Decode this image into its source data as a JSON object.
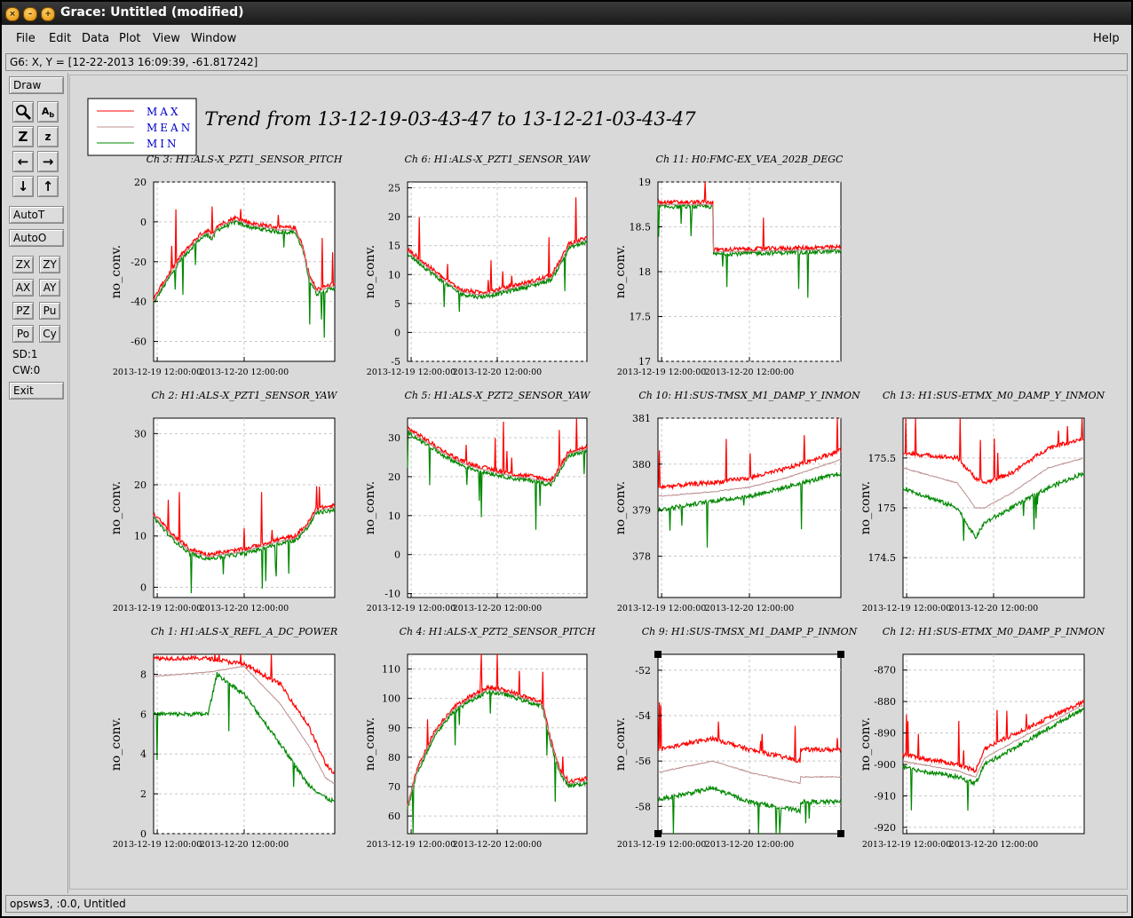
{
  "window": {
    "title": "Grace: Untitled (modified)"
  },
  "menubar": {
    "items": [
      "File",
      "Edit",
      "Data",
      "Plot",
      "View",
      "Window"
    ],
    "help": "Help"
  },
  "locator": "G6: X, Y = [12-22-2013 16:09:39, -61.817242]",
  "toolbar": {
    "draw": "Draw",
    "autot": "AutoT",
    "autoo": "AutoO",
    "zx": "ZX",
    "zy": "ZY",
    "ax": "AX",
    "ay": "AY",
    "pz": "PZ",
    "pu": "Pu",
    "po": "Po",
    "cy": "Cy",
    "sd": "SD:1",
    "cw": "CW:0",
    "exit": "Exit"
  },
  "statusbar": "opsws3, :0.0, Untitled",
  "plot": {
    "title": "Trend from 13-12-19-03-43-47 to 13-12-21-03-43-47",
    "legend": [
      "MAX",
      "MEAN",
      "MIN"
    ],
    "colors": {
      "max": "#ff0000",
      "mean": "#bc8f8f",
      "min": "#008800",
      "legend_text": "#0000cc"
    }
  },
  "chart_data": [
    {
      "type": "line",
      "title": "Ch 3: H1:ALS-X_PZT1_SENSOR_PITCH",
      "ylabel": "no_conv.",
      "ylim": [
        -70,
        20
      ],
      "yticks": [
        20,
        0,
        -20,
        -40,
        -60
      ],
      "xticks": [
        "2013-12-19 12:00:00",
        "2013-12-20 12:00:00"
      ],
      "series": [
        {
          "name": "MEAN",
          "x": [
            0,
            0.05,
            0.15,
            0.25,
            0.3,
            0.32,
            0.35,
            0.45,
            0.55,
            0.7,
            0.78,
            0.82,
            0.86,
            0.9,
            1.0
          ],
          "y": [
            -40,
            -32,
            -18,
            -8,
            -5,
            -8,
            -3,
            1,
            -2,
            -4,
            -4,
            -12,
            -28,
            -35,
            -32
          ]
        }
      ]
    },
    {
      "type": "line",
      "title": "Ch 6: H1:ALS-X_PZT1_SENSOR_YAW",
      "ylabel": "no_conv.",
      "ylim": [
        -5,
        26
      ],
      "yticks": [
        25,
        20,
        15,
        10,
        5,
        0,
        -5
      ],
      "xticks": [
        "2013-12-19 12:00:00",
        "2013-12-20 12:00:00"
      ],
      "series": [
        {
          "name": "MEAN",
          "x": [
            0,
            0.1,
            0.2,
            0.3,
            0.4,
            0.5,
            0.6,
            0.7,
            0.75,
            0.8,
            0.85,
            0.9,
            1.0
          ],
          "y": [
            14,
            11.5,
            9,
            7,
            6.5,
            7,
            7.8,
            8.5,
            9,
            9.5,
            12,
            15,
            16
          ]
        }
      ]
    },
    {
      "type": "line",
      "title": "Ch 11: H0:FMC-EX_VEA_202B_DEGC",
      "ylabel": "no_conv.",
      "ylim": [
        17,
        19
      ],
      "yticks": [
        19,
        18.5,
        18,
        17.5,
        17
      ],
      "xticks": [
        "2013-12-19 12:00:00",
        "2013-12-20 12:00:00"
      ],
      "series": [
        {
          "name": "MEAN",
          "x": [
            0,
            0.3,
            0.3,
            1.0
          ],
          "y": [
            18.75,
            18.75,
            18.22,
            18.25
          ]
        }
      ]
    },
    {
      "type": "line",
      "title": "Ch 2: H1:ALS-X_PZT1_SENSOR_YAW",
      "ylabel": "no_conv.",
      "ylim": [
        -2,
        33
      ],
      "yticks": [
        30,
        20,
        10,
        0
      ],
      "xticks": [
        "2013-12-19 12:00:00",
        "2013-12-20 12:00:00"
      ],
      "series": [
        {
          "name": "MEAN",
          "x": [
            0,
            0.1,
            0.2,
            0.3,
            0.4,
            0.5,
            0.6,
            0.7,
            0.78,
            0.85,
            0.9,
            1.0
          ],
          "y": [
            14,
            10,
            7,
            6,
            6.5,
            7,
            8,
            9,
            9.5,
            12,
            15,
            15.5
          ]
        }
      ]
    },
    {
      "type": "line",
      "title": "Ch 5: H1:ALS-X_PZT2_SENSOR_YAW",
      "ylabel": "no_conv.",
      "ylim": [
        -11,
        35
      ],
      "yticks": [
        30,
        20,
        10,
        0,
        -10
      ],
      "xticks": [
        "2013-12-19 12:00:00",
        "2013-12-20 12:00:00"
      ],
      "series": [
        {
          "name": "MEAN",
          "x": [
            0,
            0.1,
            0.2,
            0.3,
            0.4,
            0.5,
            0.6,
            0.7,
            0.75,
            0.8,
            0.85,
            0.9,
            1.0
          ],
          "y": [
            32,
            29,
            26,
            23.5,
            22,
            21,
            20,
            19.5,
            19,
            18.5,
            22,
            26,
            27
          ]
        }
      ]
    },
    {
      "type": "line",
      "title": "Ch 10: H1:SUS-TMSX_M1_DAMP_Y_INMON",
      "ylabel": "no_conv.",
      "ylim": [
        377.1,
        381
      ],
      "yticks": [
        381,
        380,
        379,
        378
      ],
      "xticks": [
        "2013-12-19 12:00:00",
        "2013-12-20 12:00:00"
      ],
      "series": [
        {
          "name": "MAX",
          "x": [
            0,
            0.3,
            0.5,
            0.7,
            1.0
          ],
          "y": [
            379.5,
            379.6,
            379.7,
            379.9,
            380.3
          ]
        },
        {
          "name": "MEAN",
          "x": [
            0,
            0.3,
            0.5,
            0.7,
            1.0
          ],
          "y": [
            379.3,
            379.4,
            379.5,
            379.7,
            380.1
          ]
        },
        {
          "name": "MIN",
          "x": [
            0,
            0.3,
            0.5,
            0.7,
            1.0
          ],
          "y": [
            379.0,
            379.2,
            379.3,
            379.5,
            379.8
          ]
        }
      ]
    },
    {
      "type": "line",
      "title": "Ch 13: H1:SUS-ETMX_M0_DAMP_Y_INMON",
      "ylabel": "no_conv.",
      "ylim": [
        174.1,
        175.9
      ],
      "yticks": [
        175.5,
        175,
        174.5
      ],
      "xticks": [
        "2013-12-19 12:00:00",
        "2013-12-20 12:00:00"
      ],
      "series": [
        {
          "name": "MAX",
          "x": [
            0,
            0.3,
            0.4,
            0.45,
            0.6,
            0.8,
            1.0
          ],
          "y": [
            175.55,
            175.5,
            175.3,
            175.25,
            175.35,
            175.6,
            175.7
          ]
        },
        {
          "name": "MEAN",
          "x": [
            0,
            0.3,
            0.4,
            0.45,
            0.6,
            0.8,
            1.0
          ],
          "y": [
            175.4,
            175.25,
            175.0,
            175.0,
            175.15,
            175.4,
            175.5
          ]
        },
        {
          "name": "MIN",
          "x": [
            0,
            0.3,
            0.4,
            0.45,
            0.6,
            0.8,
            1.0
          ],
          "y": [
            175.2,
            175.0,
            174.7,
            174.85,
            175.0,
            175.2,
            175.35
          ]
        }
      ]
    },
    {
      "type": "line",
      "title": "Ch 1: H1:ALS-X_REFL_A_DC_POWER",
      "ylabel": "no_conv.",
      "ylim": [
        0,
        9
      ],
      "yticks": [
        8,
        6,
        4,
        2,
        0
      ],
      "xticks": [
        "2013-12-19 12:00:00",
        "2013-12-20 12:00:00"
      ],
      "series": [
        {
          "name": "MAX",
          "x": [
            0,
            0.3,
            0.5,
            0.7,
            0.85,
            0.95,
            1.0
          ],
          "y": [
            8.8,
            8.8,
            8.5,
            7.5,
            5.5,
            3.5,
            3.0
          ]
        },
        {
          "name": "MEAN",
          "x": [
            0,
            0.3,
            0.5,
            0.7,
            0.85,
            0.95,
            1.0
          ],
          "y": [
            7.9,
            8.1,
            8.4,
            6.5,
            4.5,
            2.8,
            2.5
          ]
        },
        {
          "name": "MIN",
          "x": [
            0,
            0.3,
            0.35,
            0.5,
            0.7,
            0.85,
            0.95,
            1.0
          ],
          "y": [
            6.0,
            6.0,
            8.0,
            7.0,
            4.5,
            2.5,
            1.8,
            1.6
          ]
        }
      ]
    },
    {
      "type": "line",
      "title": "Ch 4: H1:ALS-X_PZT2_SENSOR_PITCH",
      "ylabel": "no_conv.",
      "ylim": [
        54,
        115
      ],
      "yticks": [
        110,
        100,
        90,
        80,
        70,
        60
      ],
      "xticks": [
        "2013-12-19 12:00:00",
        "2013-12-20 12:00:00"
      ],
      "series": [
        {
          "name": "MEAN",
          "x": [
            0,
            0.05,
            0.15,
            0.25,
            0.35,
            0.45,
            0.55,
            0.7,
            0.75,
            0.8,
            0.85,
            0.9,
            1.0
          ],
          "y": [
            63,
            75,
            88,
            96,
            100,
            103,
            102,
            99,
            98,
            85,
            75,
            71,
            72
          ]
        }
      ]
    },
    {
      "type": "line",
      "title": "Ch 9: H1:SUS-TMSX_M1_DAMP_P_INMON",
      "ylabel": "no_conv.",
      "ylim": [
        -59.2,
        -51.3
      ],
      "yticks": [
        -52,
        -54,
        -56,
        -58
      ],
      "xticks": [
        "2013-12-19 12:00:00",
        "2013-12-20 12:00:00"
      ],
      "series": [
        {
          "name": "MAX",
          "x": [
            0,
            0.3,
            0.5,
            0.78,
            0.78,
            1.0
          ],
          "y": [
            -55.5,
            -55.0,
            -55.5,
            -56.0,
            -55.5,
            -55.5
          ]
        },
        {
          "name": "MEAN",
          "x": [
            0,
            0.3,
            0.5,
            0.78,
            0.78,
            1.0
          ],
          "y": [
            -56.5,
            -56.0,
            -56.5,
            -57.0,
            -56.7,
            -56.7
          ]
        },
        {
          "name": "MIN",
          "x": [
            0,
            0.3,
            0.5,
            0.78,
            0.78,
            1.0
          ],
          "y": [
            -57.7,
            -57.2,
            -57.8,
            -58.2,
            -57.8,
            -57.8
          ]
        }
      ]
    },
    {
      "type": "line",
      "title": "Ch 12: H1:SUS-ETMX_M0_DAMP_P_INMON",
      "ylabel": "no_conv.",
      "ylim": [
        -922,
        -865
      ],
      "yticks": [
        -870,
        -880,
        -890,
        -900,
        -910,
        -920
      ],
      "xticks": [
        "2013-12-19 12:00:00",
        "2013-12-20 12:00:00"
      ],
      "series": [
        {
          "name": "MAX",
          "x": [
            0,
            0.3,
            0.4,
            0.45,
            0.7,
            1.0
          ],
          "y": [
            -897,
            -900,
            -902,
            -895,
            -888,
            -880
          ]
        },
        {
          "name": "MEAN",
          "x": [
            0,
            0.3,
            0.4,
            0.45,
            0.7,
            1.0
          ],
          "y": [
            -899,
            -902,
            -904,
            -898,
            -890,
            -881
          ]
        },
        {
          "name": "MIN",
          "x": [
            0,
            0.3,
            0.4,
            0.45,
            0.7,
            1.0
          ],
          "y": [
            -901,
            -904,
            -906,
            -900,
            -892,
            -882
          ]
        }
      ]
    }
  ]
}
